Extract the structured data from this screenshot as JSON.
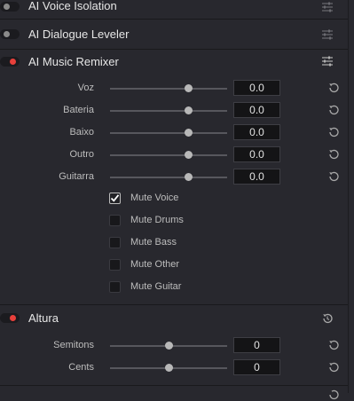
{
  "effects": [
    {
      "title": "AI Voice Isolation",
      "enabled": false
    },
    {
      "title": "AI Dialogue Leveler",
      "enabled": false
    },
    {
      "title": "AI Music Remixer",
      "enabled": true
    },
    {
      "title": "Altura",
      "enabled": true
    }
  ],
  "music_remixer": {
    "params": [
      {
        "label": "Voz",
        "value": "0.0",
        "level": 0.66
      },
      {
        "label": "Bateria",
        "value": "0.0",
        "level": 0.66
      },
      {
        "label": "Baixo",
        "value": "0.0",
        "level": 0.66
      },
      {
        "label": "Outro",
        "value": "0.0",
        "level": 0.66
      },
      {
        "label": "Guitarra",
        "value": "0.0",
        "level": 0.66
      }
    ],
    "mutes": [
      {
        "label": "Mute Voice",
        "checked": true
      },
      {
        "label": "Mute Drums",
        "checked": false
      },
      {
        "label": "Mute Bass",
        "checked": false
      },
      {
        "label": "Mute Other",
        "checked": false
      },
      {
        "label": "Mute Guitar",
        "checked": false
      }
    ]
  },
  "altura": {
    "params": [
      {
        "label": "Semitons",
        "value": "0",
        "level": 0.5
      },
      {
        "label": "Cents",
        "value": "0",
        "level": 0.5
      }
    ]
  },
  "colors": {
    "accent": "#e8403b",
    "panel": "#28282e",
    "field": "#141416"
  },
  "icons": {
    "settings": "sliders-icon",
    "reset": "reset-icon",
    "reset_clock": "reset-history-icon",
    "check": "checkmark-icon"
  }
}
